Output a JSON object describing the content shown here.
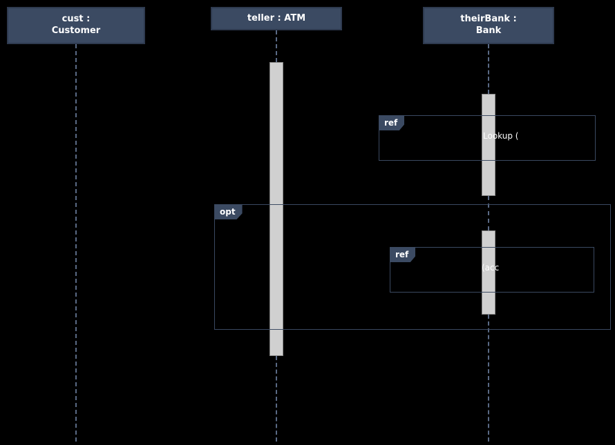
{
  "lifelines": {
    "cust": {
      "label": "cust :\nCustomer"
    },
    "teller": {
      "label": "teller : ATM"
    },
    "bank": {
      "label": "theirBank :\nBank"
    }
  },
  "frames": {
    "ref1": {
      "tag": "ref",
      "text": "Lookup ("
    },
    "opt": {
      "tag": "opt",
      "text": ""
    },
    "ref2": {
      "tag": "ref",
      "text": "(acc"
    }
  },
  "chart_data": {
    "type": "sequence-diagram",
    "lifelines": [
      {
        "id": "cust",
        "name": "cust",
        "class": "Customer"
      },
      {
        "id": "teller",
        "name": "teller",
        "class": "ATM"
      },
      {
        "id": "bank",
        "name": "theirBank",
        "class": "Bank"
      }
    ],
    "activations": [
      {
        "lifeline": "teller",
        "kind": "main"
      },
      {
        "lifeline": "bank",
        "kind": "ref1"
      },
      {
        "lifeline": "bank",
        "kind": "ref2"
      }
    ],
    "fragments": [
      {
        "type": "ref",
        "label": "ref",
        "covers": [
          "bank"
        ],
        "text": "Lookup ("
      },
      {
        "type": "opt",
        "label": "opt",
        "covers": [
          "teller",
          "bank"
        ],
        "children": [
          {
            "type": "ref",
            "label": "ref",
            "covers": [
              "bank"
            ],
            "text": "(acc"
          }
        ]
      }
    ]
  }
}
